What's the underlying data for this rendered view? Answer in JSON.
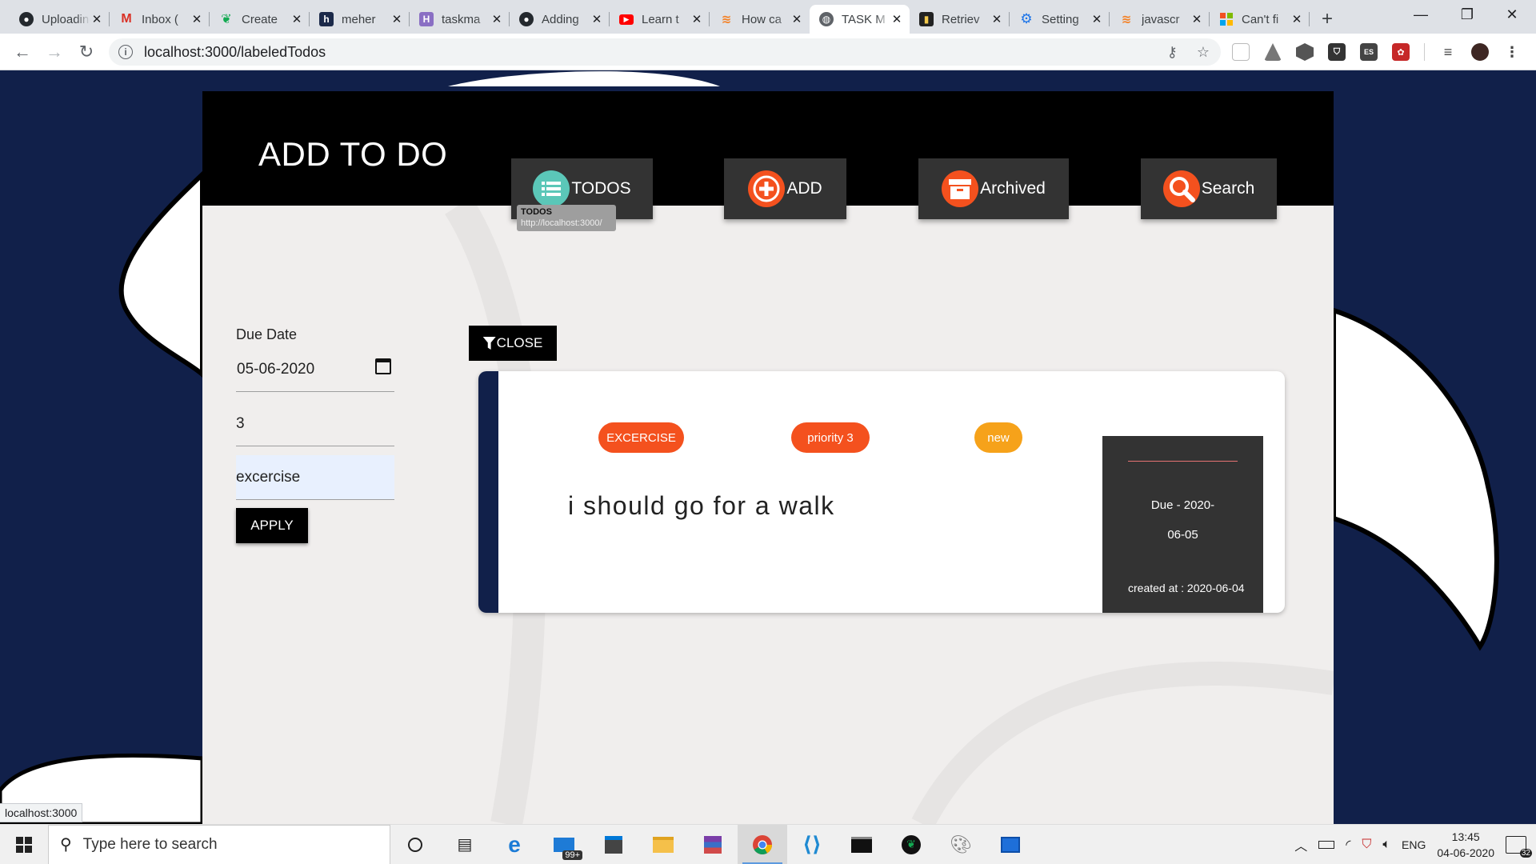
{
  "browser": {
    "tabs": [
      {
        "title": "Uploading",
        "icon": "github-icon"
      },
      {
        "title": "Inbox (",
        "icon": "gmail-icon"
      },
      {
        "title": "Create",
        "icon": "mongodb-leaf-icon"
      },
      {
        "title": "meher",
        "icon": "hashnode-icon"
      },
      {
        "title": "taskma",
        "icon": "heroku-icon"
      },
      {
        "title": "Adding",
        "icon": "github-icon"
      },
      {
        "title": "Learn t",
        "icon": "youtube-icon"
      },
      {
        "title": "How ca",
        "icon": "stackoverflow-icon"
      },
      {
        "title": "TASK M",
        "icon": "globe-icon",
        "active": true
      },
      {
        "title": "Retriev",
        "icon": "dev-icon"
      },
      {
        "title": "Setting",
        "icon": "gear-icon"
      },
      {
        "title": "javascr",
        "icon": "stackoverflow-icon"
      },
      {
        "title": "Can't fi",
        "icon": "microsoft-icon"
      }
    ],
    "url": "localhost:3000/labeledTodos",
    "status_url": "localhost:3000"
  },
  "app": {
    "title": "ADD TO DO",
    "nav": [
      {
        "label": "TODOS",
        "icon": "list-icon"
      },
      {
        "label": "ADD",
        "icon": "plus-icon"
      },
      {
        "label": "Archived",
        "icon": "archive-icon"
      },
      {
        "label": "Search",
        "icon": "search-icon"
      }
    ],
    "tooltip": {
      "title": "TODOS",
      "url": "http://localhost:3000/"
    },
    "filter": {
      "due_date_label": "Due Date",
      "due_date_value": "05-06-2020",
      "priority_value": "3",
      "label_value": "excercise",
      "apply_label": "APPLY",
      "close_label": "CLOSE"
    },
    "todo": {
      "badges": [
        "EXCERCISE",
        "priority 3",
        "new"
      ],
      "text": "i should go for a walk",
      "due_line1": "Due - 2020-",
      "due_line2": "06-05",
      "created": "created at : 2020-06-04"
    },
    "colors": {
      "accent": "#f4511e",
      "new_badge": "#f6a21a",
      "nav_card": "#333333",
      "page_bg": "#11204a"
    }
  },
  "taskbar": {
    "search_placeholder": "Type here to search",
    "mail_badge": "99+",
    "language": "ENG",
    "time": "13:45",
    "date": "04-06-2020",
    "notification_count": "32"
  }
}
